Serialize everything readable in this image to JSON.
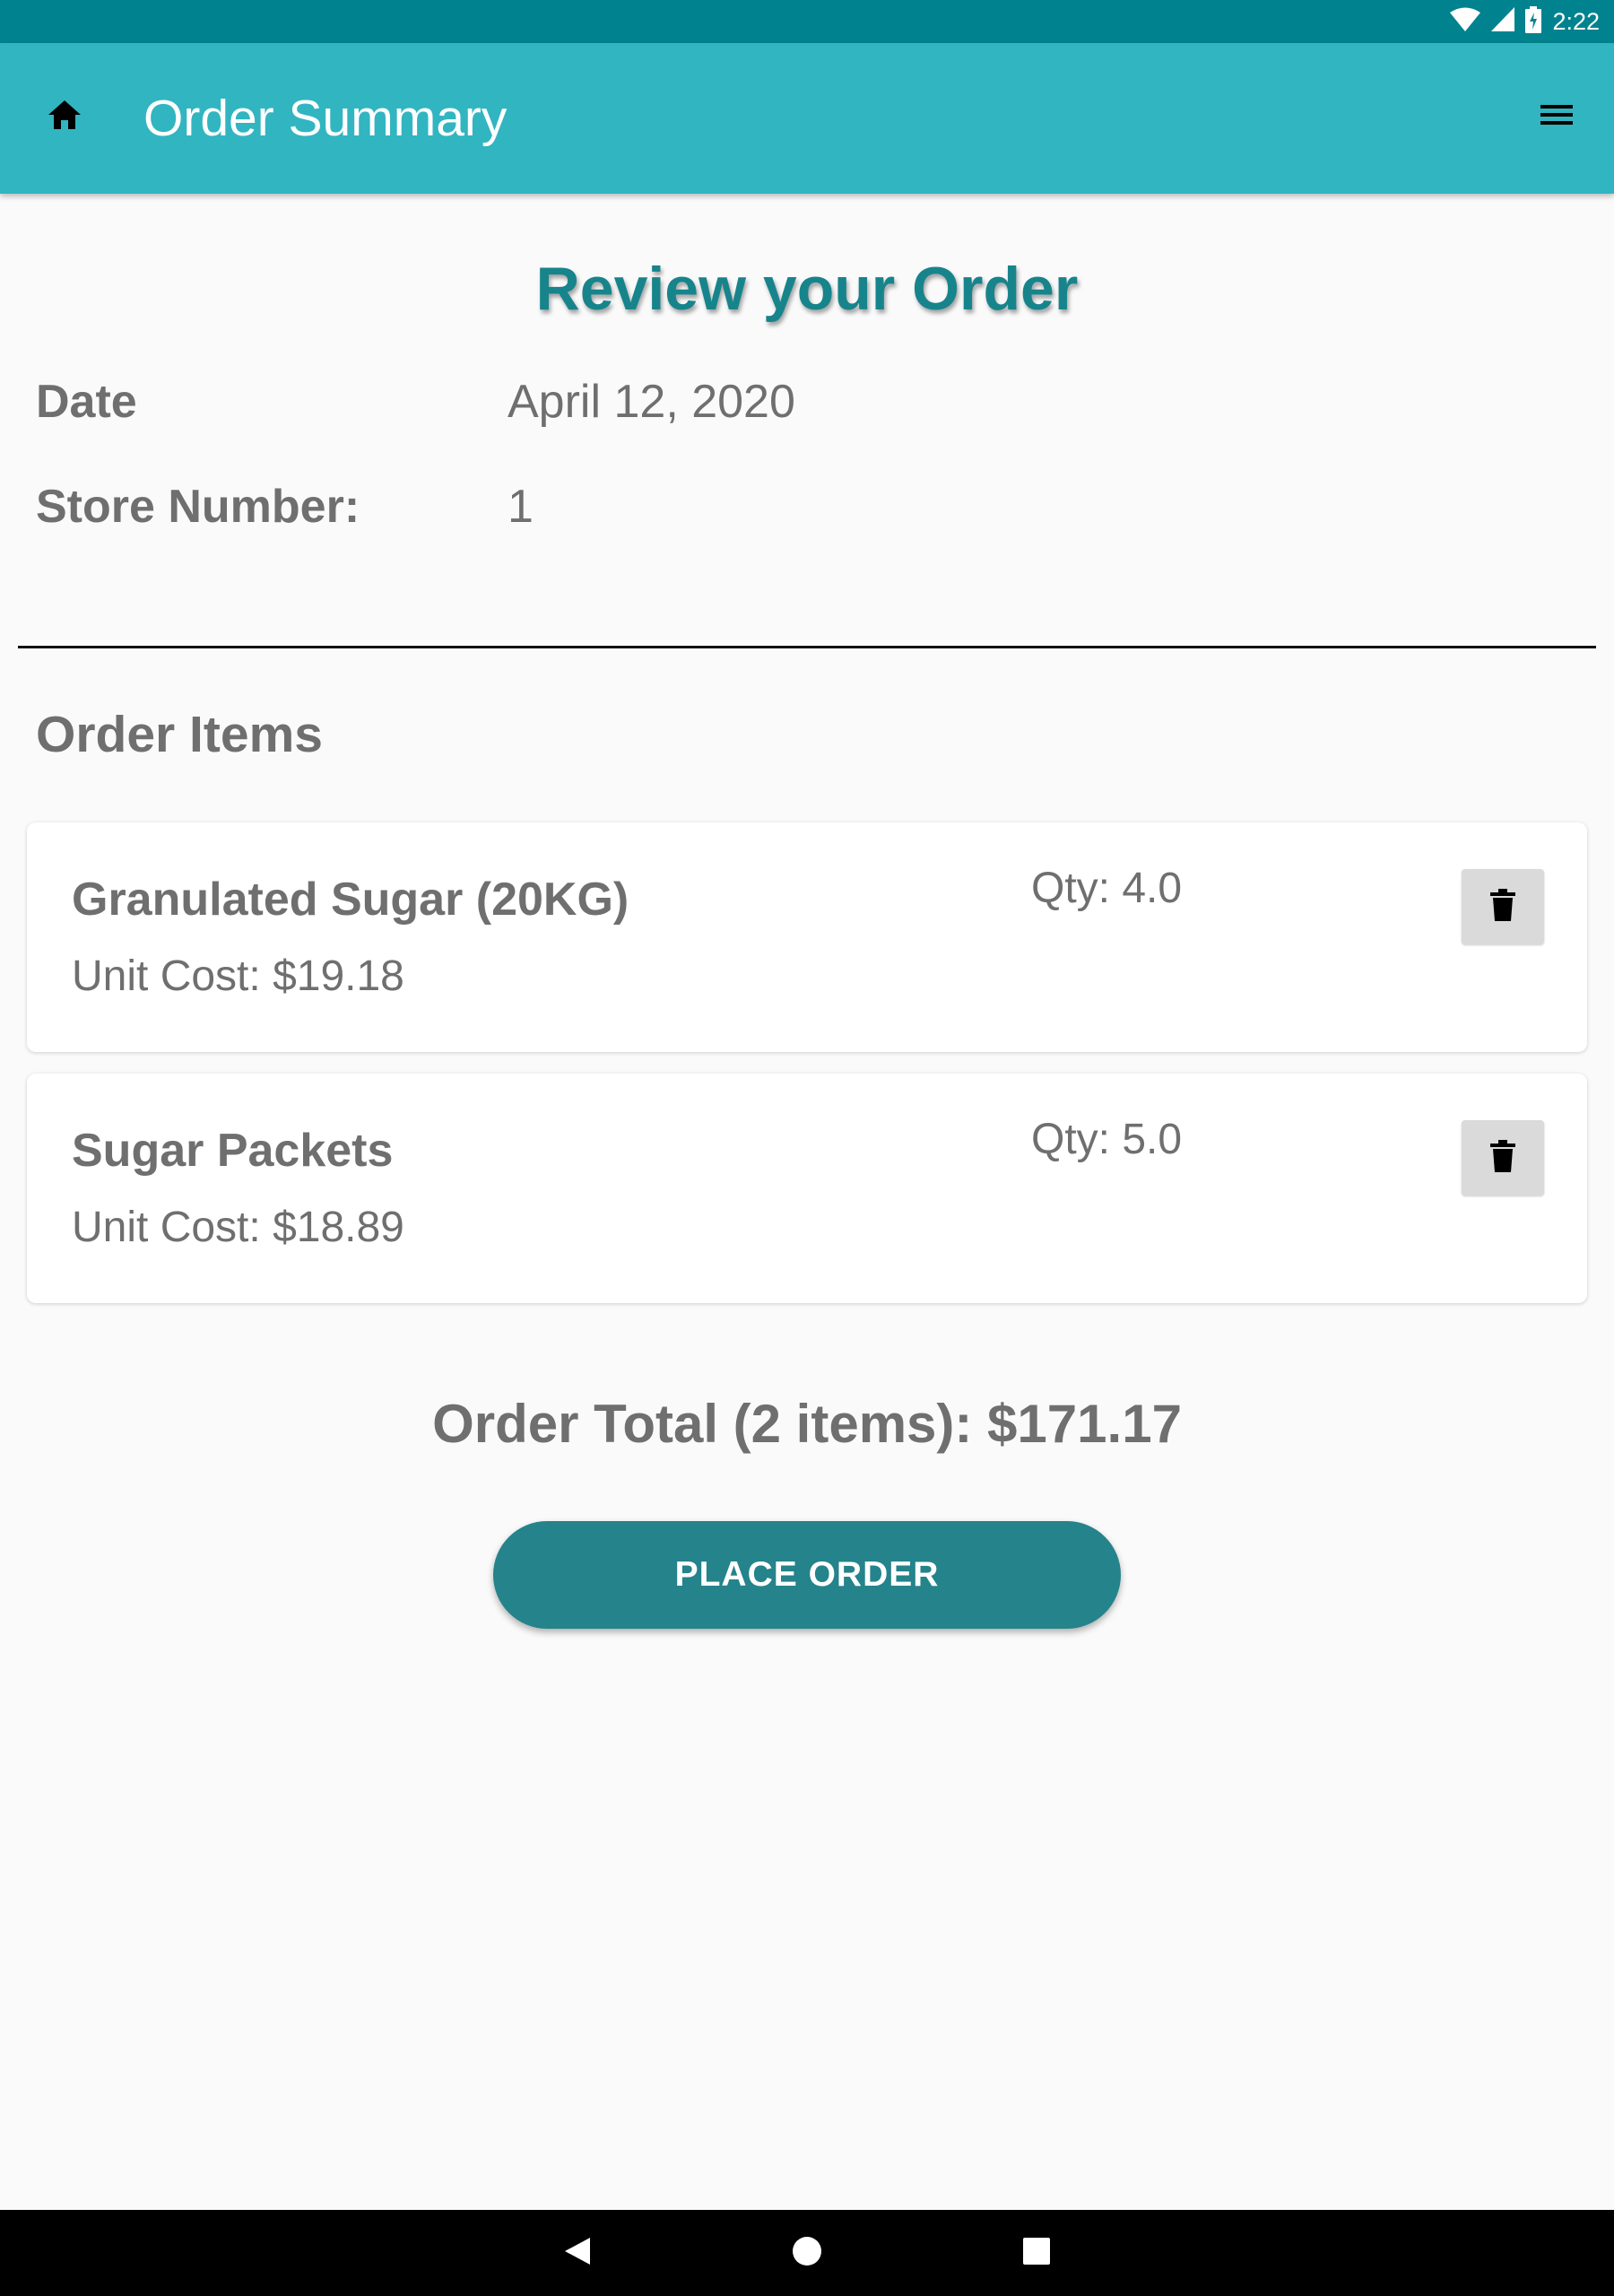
{
  "status_bar": {
    "time": "2:22",
    "icons": [
      "wifi-icon",
      "cellular-signal-icon",
      "battery-charging-icon"
    ]
  },
  "app_bar": {
    "title": "Order Summary",
    "icons": [
      "home-icon",
      "menu-icon"
    ],
    "color": "#31b5c1"
  },
  "review": {
    "title": "Review your Order",
    "date_label": "Date",
    "date_value": "April 12, 2020",
    "store_label": "Store Number:",
    "store_value": "1"
  },
  "order_items": {
    "title": "Order Items",
    "items": [
      {
        "name": "Granulated Sugar (20KG)",
        "unit_cost": "Unit Cost: $19.18",
        "qty": "Qty: 4.0",
        "icon": "trash-icon"
      },
      {
        "name": "Sugar Packets",
        "unit_cost": "Unit Cost: $18.89",
        "qty": "Qty: 5.0",
        "icon": "trash-icon"
      }
    ]
  },
  "order_total": "Order Total (2 items): $171.17",
  "place_order_label": "PLACE ORDER",
  "navigation": {
    "icons": [
      "back-icon",
      "home-circle-icon",
      "recents-icon"
    ]
  },
  "colors": {
    "status_bar": "#00838f",
    "accent": "#17848c",
    "button": "#24838b",
    "text": "#6f6f6f"
  }
}
